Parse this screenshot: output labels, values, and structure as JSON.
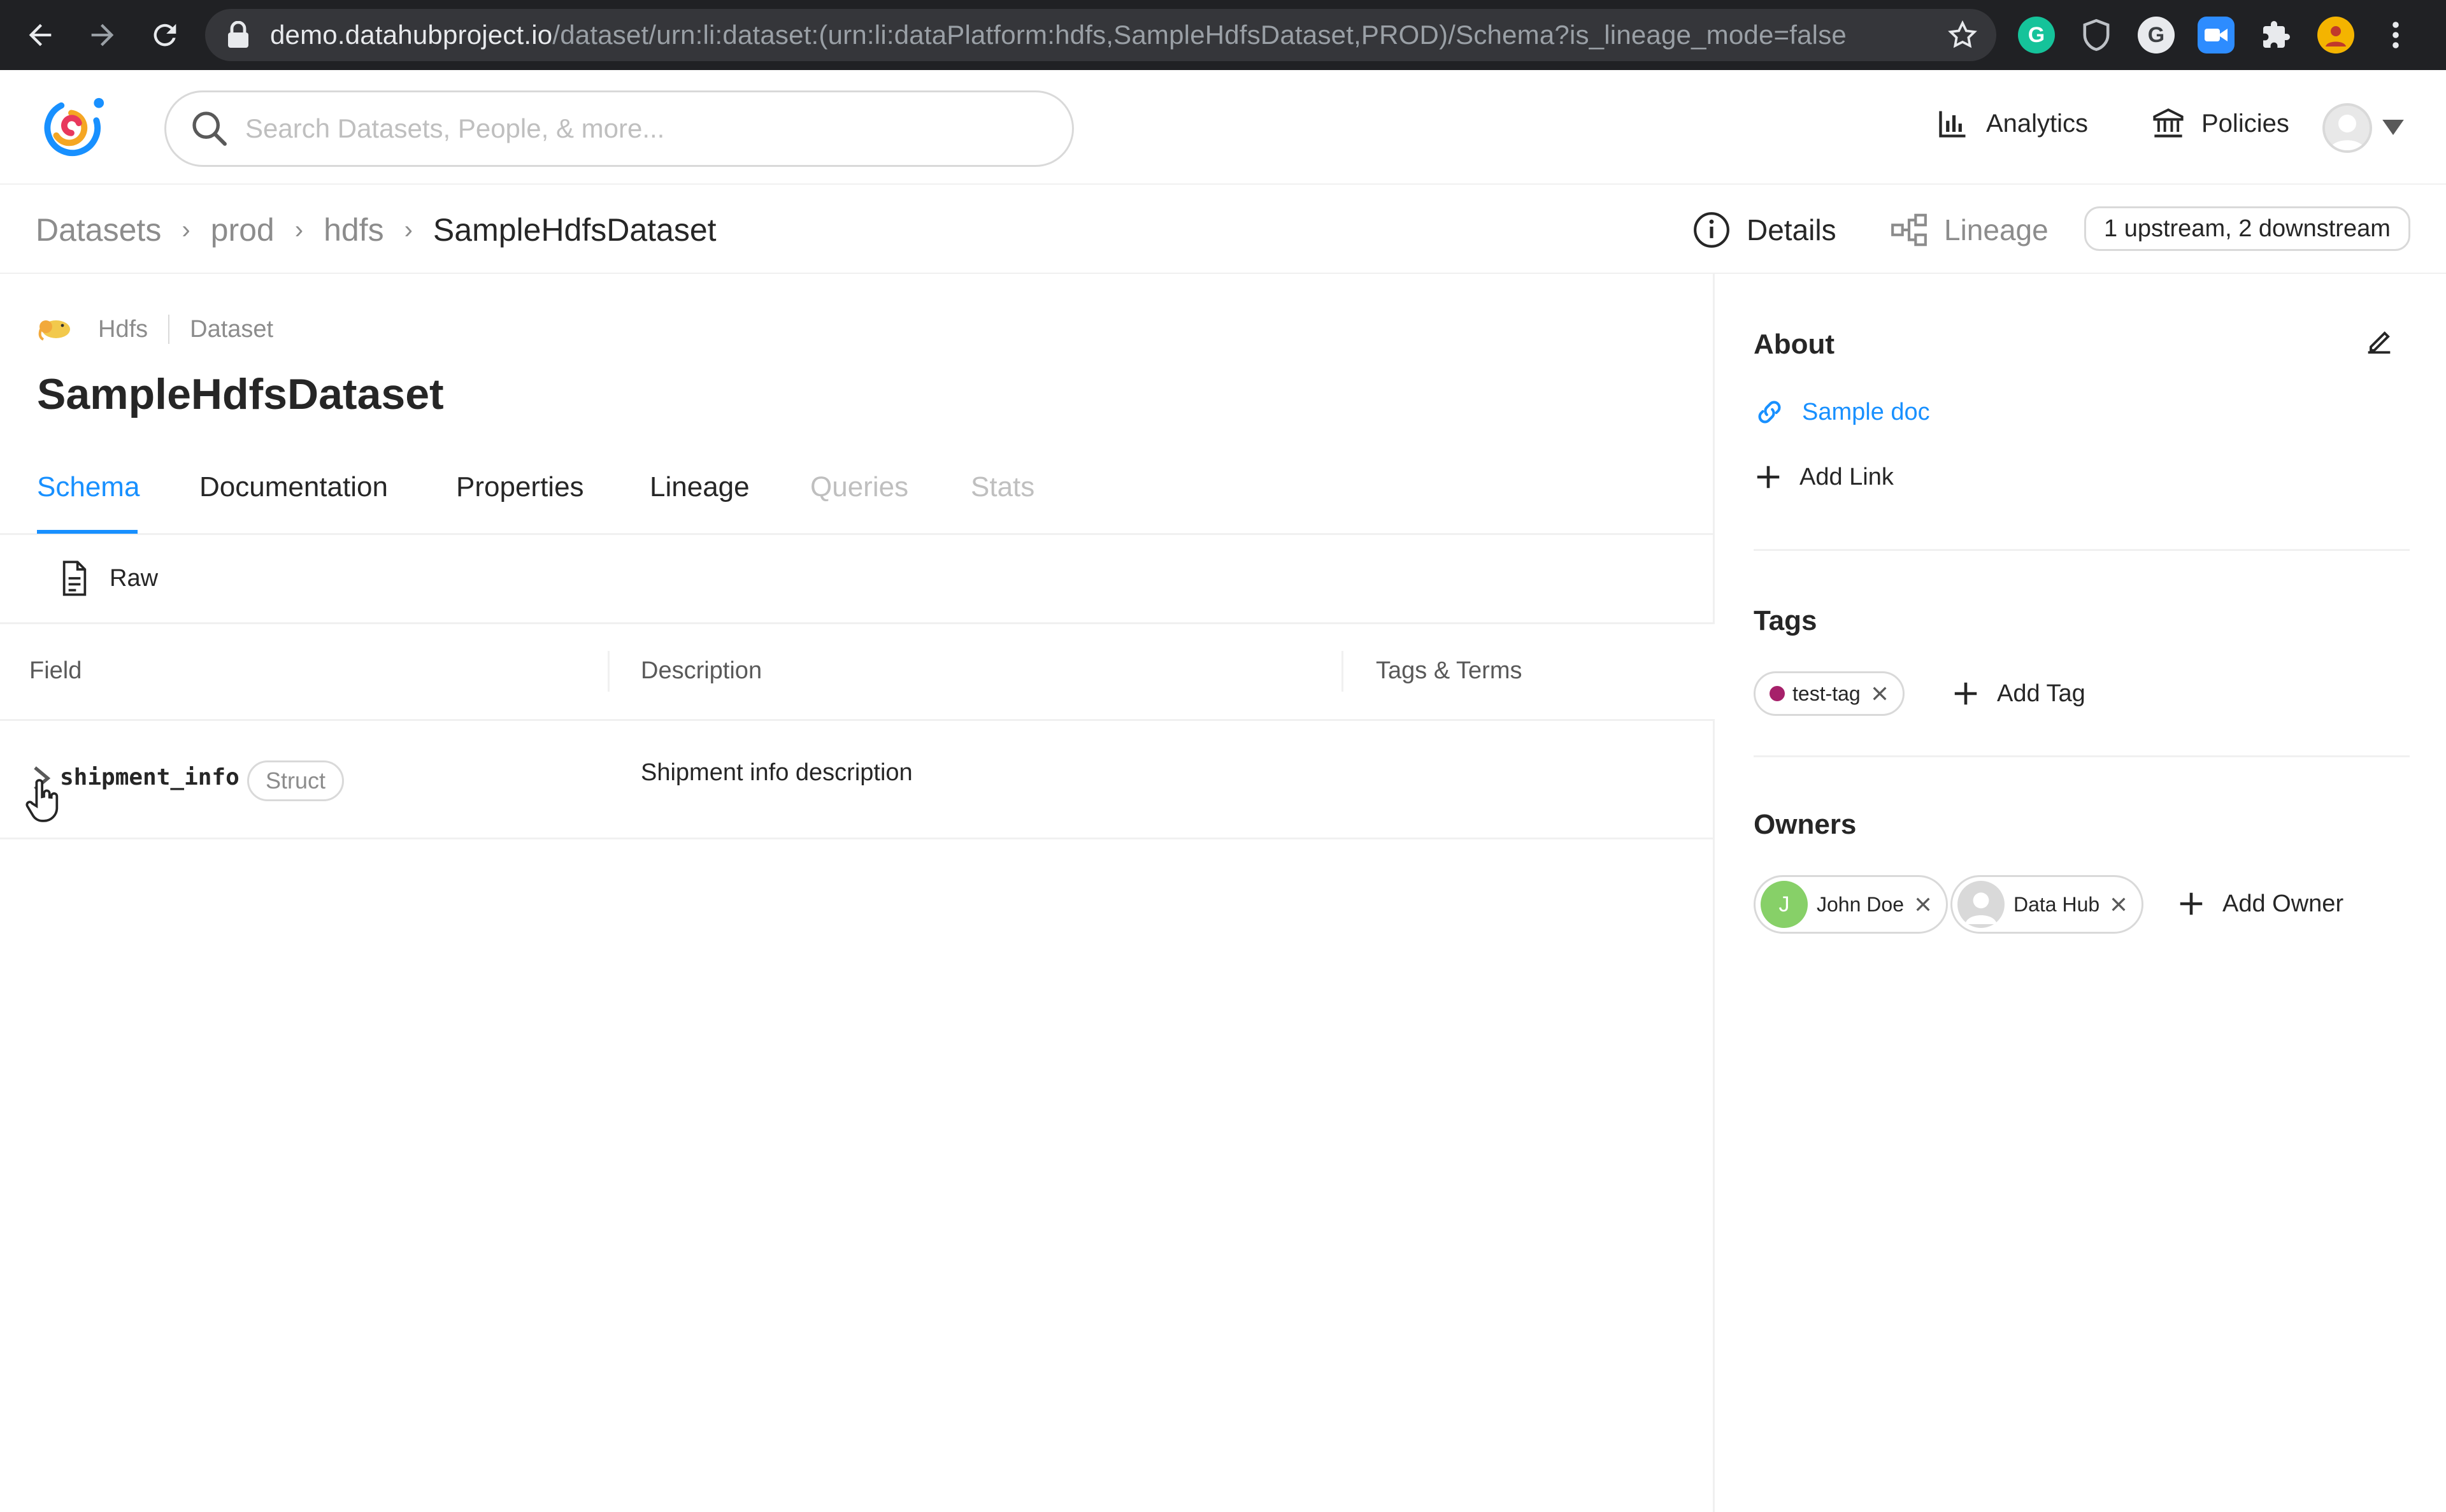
{
  "browser": {
    "url_host": "demo.datahubproject.io",
    "url_path": "/dataset/urn:li:dataset:(urn:li:dataPlatform:hdfs,SampleHdfsDataset,PROD)/Schema?is_lineage_mode=false",
    "extensions": [
      "grammarly-icon",
      "shield-ext-icon",
      "g-ext-icon",
      "zoom-ext-icon",
      "puzzle-icon",
      "profile-avatar-icon",
      "kebab-menu-icon"
    ]
  },
  "header": {
    "search_placeholder": "Search Datasets, People, & more...",
    "analytics_label": "Analytics",
    "policies_label": "Policies"
  },
  "breadcrumb": {
    "items": [
      "Datasets",
      "prod",
      "hdfs",
      "SampleHdfsDataset"
    ]
  },
  "view_toggle": {
    "details_label": "Details",
    "lineage_label": "Lineage",
    "lineage_summary": "1 upstream, 2 downstream"
  },
  "entity": {
    "platform": "Hdfs",
    "type": "Dataset",
    "name": "SampleHdfsDataset"
  },
  "tabs": [
    {
      "label": "Schema",
      "state": "active"
    },
    {
      "label": "Documentation",
      "state": "normal"
    },
    {
      "label": "Properties",
      "state": "normal"
    },
    {
      "label": "Lineage",
      "state": "normal"
    },
    {
      "label": "Queries",
      "state": "disabled"
    },
    {
      "label": "Stats",
      "state": "disabled"
    }
  ],
  "schema": {
    "raw_label": "Raw",
    "columns": [
      "Field",
      "Description",
      "Tags & Terms"
    ],
    "rows": [
      {
        "field": "shipment_info",
        "type": "Struct",
        "description": "Shipment info description"
      }
    ]
  },
  "sidebar": {
    "about": {
      "title": "About",
      "link_label": "Sample doc",
      "add_link_label": "Add Link"
    },
    "tags": {
      "title": "Tags",
      "items": [
        {
          "label": "test-tag",
          "color": "#a6206a"
        }
      ],
      "add_label": "Add Tag"
    },
    "owners": {
      "title": "Owners",
      "items": [
        {
          "name": "John Doe",
          "initial": "J",
          "avatar_color": "#87d068"
        },
        {
          "name": "Data Hub",
          "initial": "",
          "avatar_color": "#d9d9d9"
        }
      ],
      "add_label": "Add Owner"
    }
  },
  "colors": {
    "accent": "#1890ff",
    "chrome_bg": "#202124"
  }
}
